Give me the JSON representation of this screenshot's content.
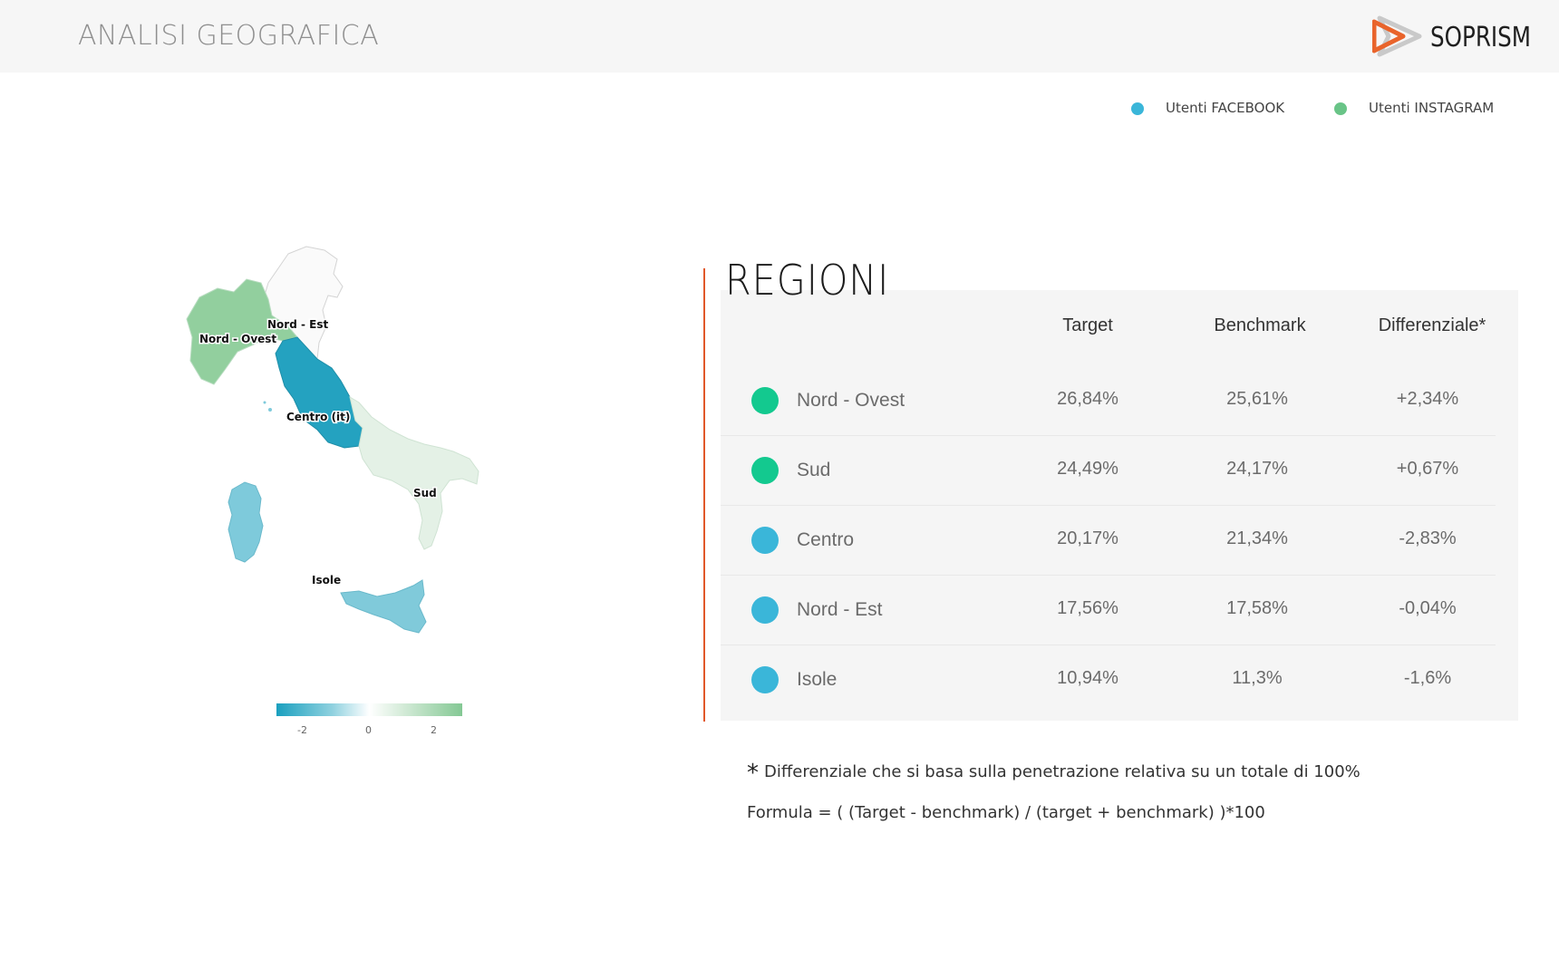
{
  "header": {
    "title": "ANALISI GEOGRAFICA",
    "logo_text": "SOPRISM"
  },
  "legend": [
    {
      "label": "Utenti FACEBOOK",
      "color": "#3ab6d9"
    },
    {
      "label": "Utenti INSTAGRAM",
      "color": "#69c487"
    }
  ],
  "map": {
    "labels": {
      "nord_ovest": "Nord - Ovest",
      "nord_est": "Nord - Est",
      "centro": "Centro (it)",
      "sud": "Sud",
      "isole": "Isole"
    },
    "colors": {
      "nord_ovest": "#92cf9e",
      "nord_est": "#fafafa",
      "centro": "#24a2c0",
      "sud": "#e4f1e6",
      "sardegna": "#7ecadb",
      "sicilia": "#80cada"
    },
    "scale_ticks": [
      "-2",
      "0",
      "2"
    ]
  },
  "regions_table": {
    "title": "REGIONI",
    "columns": [
      "Target",
      "Benchmark",
      "Differenziale*"
    ],
    "rows": [
      {
        "name": "Nord - Ovest",
        "target": "26,84%",
        "benchmark": "25,61%",
        "diff": "+2,34%",
        "color": "#13c98f"
      },
      {
        "name": "Sud",
        "target": "24,49%",
        "benchmark": "24,17%",
        "diff": "+0,67%",
        "color": "#13c98f"
      },
      {
        "name": "Centro",
        "target": "20,17%",
        "benchmark": "21,34%",
        "diff": "-2,83%",
        "color": "#3ab6d9"
      },
      {
        "name": "Nord - Est",
        "target": "17,56%",
        "benchmark": "17,58%",
        "diff": "-0,04%",
        "color": "#3ab6d9"
      },
      {
        "name": "Isole",
        "target": "10,94%",
        "benchmark": "11,3%",
        "diff": "-1,6%",
        "color": "#3ab6d9"
      }
    ]
  },
  "footnote": {
    "star": "*",
    "text": "Differenziale che si basa sulla penetrazione relativa su un totale di 100%",
    "formula": "Formula = ( (Target - benchmark) / (target + benchmark) )*100"
  }
}
